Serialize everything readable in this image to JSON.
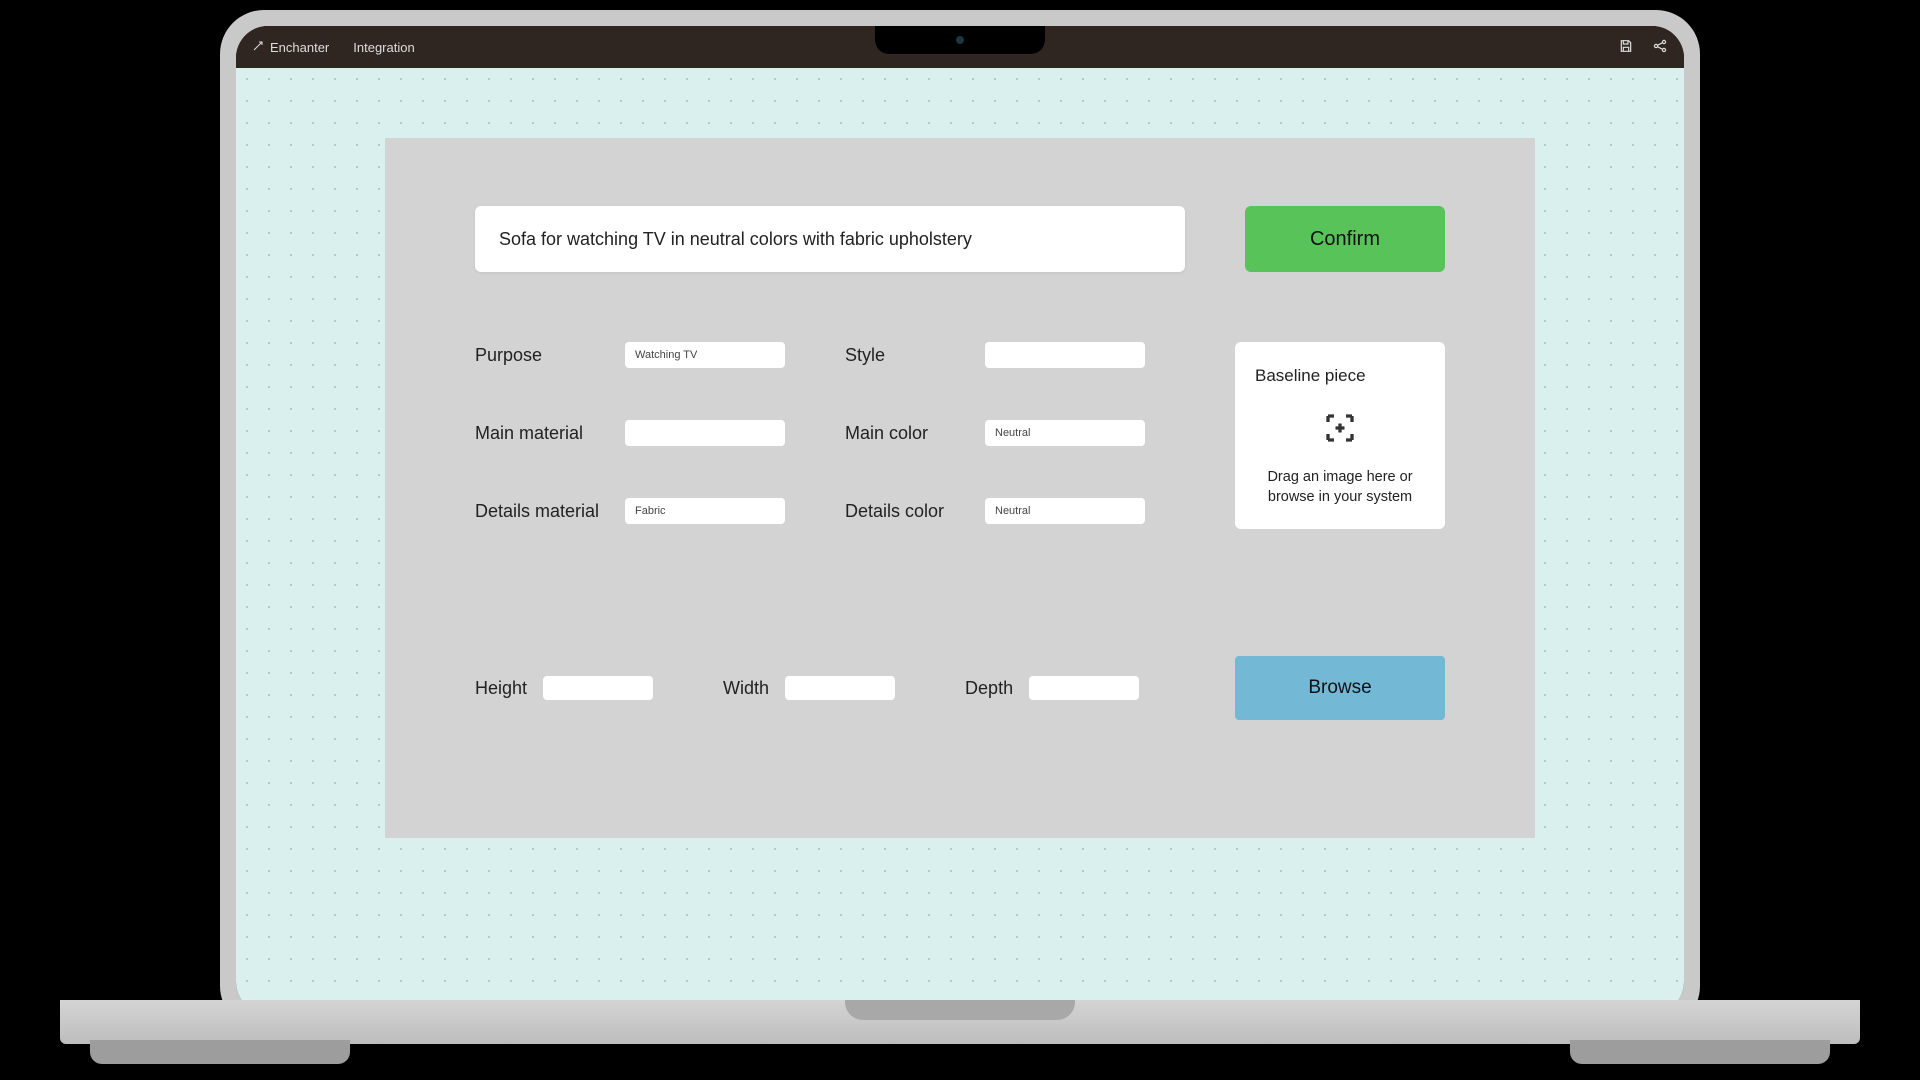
{
  "titlebar": {
    "app": "Enchanter",
    "menu": "Integration"
  },
  "query": "Sofa for watching TV in neutral colors with fabric upholstery",
  "buttons": {
    "confirm": "Confirm",
    "browse": "Browse"
  },
  "fields": {
    "purpose": {
      "label": "Purpose",
      "value": "Watching TV"
    },
    "style": {
      "label": "Style",
      "value": ""
    },
    "main_material": {
      "label": "Main material",
      "value": ""
    },
    "main_color": {
      "label": "Main color",
      "value": "Neutral"
    },
    "details_material": {
      "label": "Details material",
      "value": "Fabric"
    },
    "details_color": {
      "label": "Details color",
      "value": "Neutral"
    }
  },
  "dimensions": {
    "height": {
      "label": "Height",
      "value": ""
    },
    "width": {
      "label": "Width",
      "value": ""
    },
    "depth": {
      "label": "Depth",
      "value": ""
    }
  },
  "baseline": {
    "title": "Baseline piece",
    "help": "Drag an image here or browse in your system"
  }
}
